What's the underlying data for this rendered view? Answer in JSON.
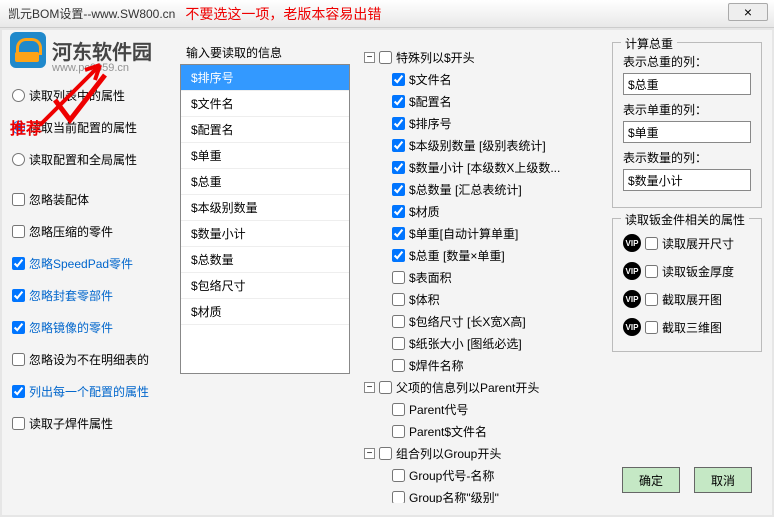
{
  "window": {
    "title": "凯元BOM设置--www.SW800.cn",
    "warning": "不要选这一项，老版本容易出错",
    "close": "×"
  },
  "watermark": {
    "name": "河东软件园",
    "url": "www.pc0359.cn"
  },
  "recommend": "推荐",
  "radios": {
    "r1": "读取列表中的属性",
    "r2": "读取当前配置的属性",
    "r3": "读取配置和全局属性"
  },
  "checks": {
    "c1": "忽略装配体",
    "c2": "忽略压缩的零件",
    "c3": "忽略SpeedPad零件",
    "c4": "忽略封套零部件",
    "c5": "忽略镜像的零件",
    "c6": "忽略设为不在明细表的",
    "c7": "列出每一个配置的属性",
    "c8": "读取子焊件属性"
  },
  "list": {
    "header": "输入要读取的信息",
    "items": [
      "$排序号",
      "$文件名",
      "$配置名",
      "$单重",
      "$总重",
      "$本级别数量",
      "$数量小计",
      "$总数量",
      "$包络尺寸",
      "$材质"
    ]
  },
  "tree": {
    "n0": "特殊列以$开头",
    "n1": "$文件名",
    "n2": "$配置名",
    "n3": "$排序号",
    "n4": "$本级别数量 [级别表统计]",
    "n5": "$数量小计 [本级数X上级数...",
    "n6": "$总数量 [汇总表统计]",
    "n7": "$材质",
    "n8": "$单重[自动计算单重]",
    "n9": "$总重 [数量×单重]",
    "n10": "$表面积",
    "n11": "$体积",
    "n12": "$包络尺寸 [长X宽X高]",
    "n13": "$纸张大小 [图纸必选]",
    "n14": "$焊件名称",
    "p0": "父项的信息列以Parent开头",
    "p1": "Parent代号",
    "p2": "Parent$文件名",
    "g0": "组合列以Group开头",
    "g1": "Group代号-名称",
    "g2": "Group名称\"级别\""
  },
  "calc": {
    "title": "计算总重",
    "l1": "表示总重的列：",
    "v1": "$总重",
    "l2": "表示单重的列：",
    "v2": "$单重",
    "l3": "表示数量的列：",
    "v3": "$数量小计"
  },
  "sheet": {
    "title": "读取钣金件相关的属性",
    "s1": "读取展开尺寸",
    "s2": "读取钣金厚度",
    "s3": "截取展开图",
    "s4": "截取三维图"
  },
  "buttons": {
    "ok": "确定",
    "cancel": "取消"
  }
}
